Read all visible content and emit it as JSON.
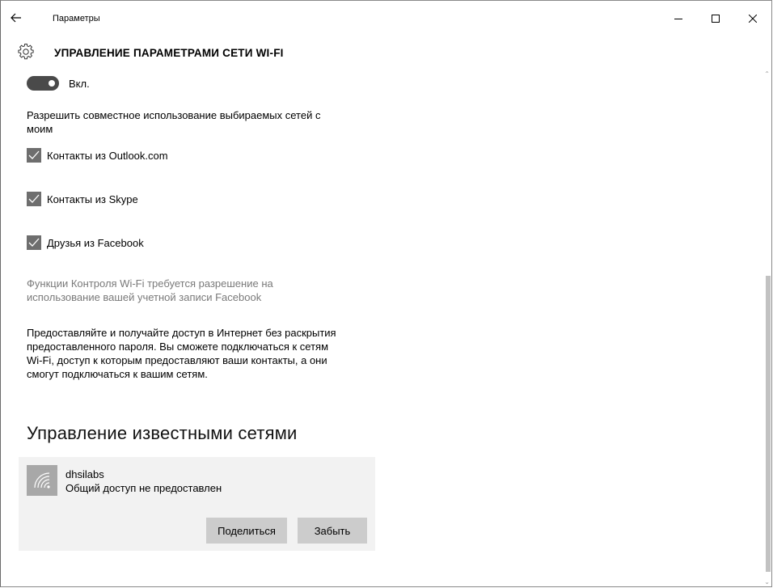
{
  "window": {
    "app_title": "Параметры",
    "page_title": "УПРАВЛЕНИЕ ПАРАМЕТРАМИ СЕТИ WI-FI"
  },
  "toggle": {
    "label": "Вкл.",
    "state": "on"
  },
  "share_heading": {
    "line1": "Разрешить совместное использование выбираемых сетей с",
    "line2": "моим"
  },
  "checkboxes": [
    {
      "label": "Контакты из Outlook.com",
      "checked": true
    },
    {
      "label": "Контакты из Skype",
      "checked": true
    },
    {
      "label": "Друзья из Facebook",
      "checked": true
    }
  ],
  "facebook_note": {
    "line1": "Функции Контроля Wi-Fi требуется разрешение на",
    "line2": "использование вашей учетной записи Facebook"
  },
  "description": {
    "line1": "Предоставляйте и получайте доступ в Интернет без раскрытия",
    "line2": "предоставленного пароля. Вы сможете подключаться к сетям",
    "line3": "Wi-Fi, доступ к которым предоставляют ваши контакты, а они",
    "line4": "смогут подключаться к вашим сетям."
  },
  "known_networks": {
    "title": "Управление известными сетями",
    "items": [
      {
        "name": "dhsilabs",
        "status": "Общий доступ не предоставлен",
        "share_label": "Поделиться",
        "forget_label": "Забыть"
      }
    ]
  },
  "colors": {
    "toggle_on": "#4a4a4a",
    "checkbox": "#6e6e6e",
    "card_bg": "#f2f2f2",
    "button_bg": "#cccccc",
    "muted_text": "#7a7a7a"
  }
}
